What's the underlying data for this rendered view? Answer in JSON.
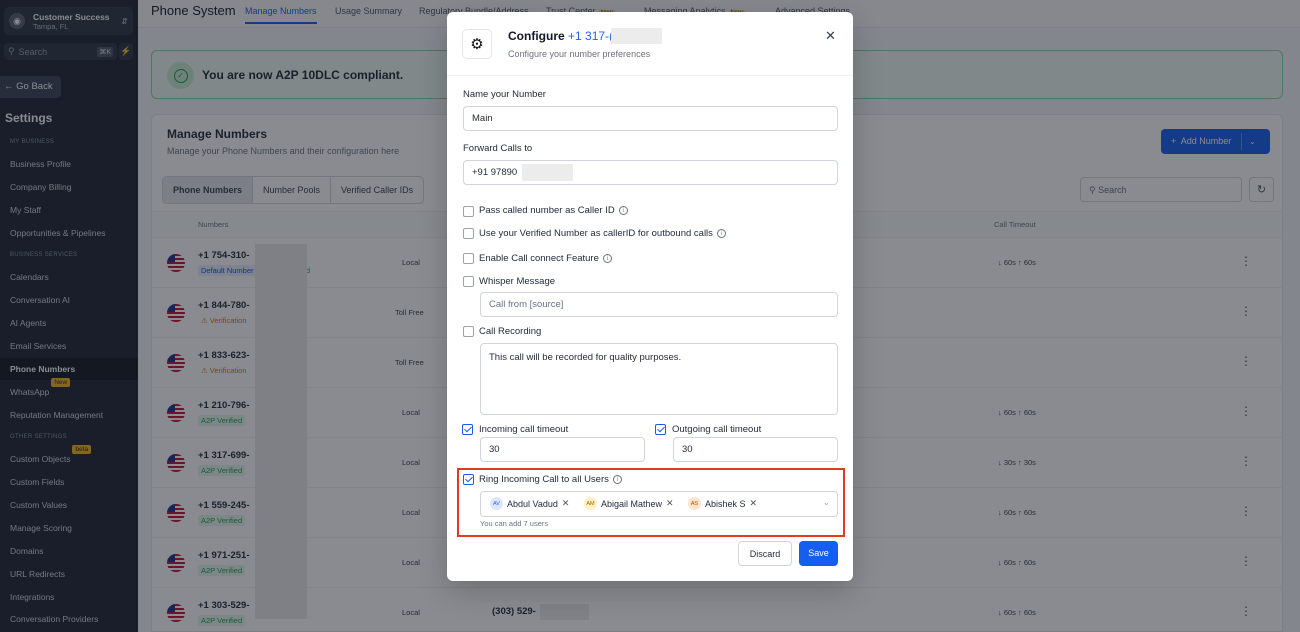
{
  "sidebar": {
    "account": {
      "name": "Customer Success",
      "location": "Tampa, FL"
    },
    "search": {
      "placeholder": "Search",
      "shortcut": "⌘K"
    },
    "go_back": "Go Back",
    "settings_title": "Settings",
    "sections": {
      "my_business": "MY BUSINESS",
      "business_services": "BUSINESS SERVICES",
      "other_settings": "OTHER SETTINGS"
    },
    "items": [
      {
        "label": "Business Profile"
      },
      {
        "label": "Company Billing"
      },
      {
        "label": "My Staff"
      },
      {
        "label": "Opportunities & Pipelines"
      },
      {
        "label": "Calendars"
      },
      {
        "label": "Conversation AI"
      },
      {
        "label": "AI Agents"
      },
      {
        "label": "Email Services"
      },
      {
        "label": "Phone Numbers"
      },
      {
        "label": "WhatsApp",
        "badge": "New"
      },
      {
        "label": "Reputation Management"
      },
      {
        "label": "Custom Objects",
        "badge": "beta"
      },
      {
        "label": "Custom Fields"
      },
      {
        "label": "Custom Values"
      },
      {
        "label": "Manage Scoring"
      },
      {
        "label": "Domains"
      },
      {
        "label": "URL Redirects"
      },
      {
        "label": "Integrations"
      },
      {
        "label": "Conversation Providers"
      }
    ]
  },
  "header": {
    "title": "Phone System",
    "tabs": [
      {
        "label": "Manage Numbers"
      },
      {
        "label": "Usage Summary"
      },
      {
        "label": "Regulatory Bundle/Address"
      },
      {
        "label": "Trust Center",
        "badge": "New"
      },
      {
        "label": "Messaging Analytics",
        "badge": "New"
      },
      {
        "label": "Advanced Settings"
      }
    ]
  },
  "banner": {
    "message": "You are now A2P 10DLC compliant."
  },
  "manage": {
    "title": "Manage Numbers",
    "subtitle": "Manage your Phone Numbers and their configuration here",
    "add_button": "Add Number",
    "segments": [
      "Phone Numbers",
      "Number Pools",
      "Verified Caller IDs"
    ],
    "search_placeholder": "Search",
    "columns": {
      "numbers": "Numbers",
      "call_timeout": "Call Timeout"
    },
    "rows": [
      {
        "number": "+1 754-310-",
        "badge": "Default Number",
        "badge_extra": "ied",
        "type": "Local",
        "timeout": "↓ 60s   ↑ 60s"
      },
      {
        "number": "+1 844-780-",
        "badge": "⚠ Verification",
        "type": "Toll Free",
        "timeout": ""
      },
      {
        "number": "+1 833-623-",
        "badge": "⚠ Verification",
        "type": "Toll Free",
        "timeout": ""
      },
      {
        "number": "+1 210-796-",
        "badge": "A2P Verified",
        "type": "Local",
        "timeout": "↓ 60s   ↑ 60s"
      },
      {
        "number": "+1 317-699-",
        "badge": "A2P Verified",
        "type": "Local",
        "timeout": "↓ 30s   ↑ 30s"
      },
      {
        "number": "+1 559-245-",
        "badge": "A2P Verified",
        "type": "Local",
        "timeout": "↓ 60s   ↑ 60s"
      },
      {
        "number": "+1 971-251-",
        "badge": "A2P Verified",
        "type": "Local",
        "timeout": "↓ 60s   ↑ 60s"
      },
      {
        "number": "+1 303-529-",
        "badge": "A2P Verified",
        "type": "Local",
        "timeout": "↓ 60s   ↑ 60s",
        "extra": "(303) 529-"
      }
    ]
  },
  "modal": {
    "title": "Configure",
    "phone": "+1 317-(",
    "subtitle": "Configure your number preferences",
    "name_label": "Name your Number",
    "name_value": "Main",
    "forward_label": "Forward Calls to",
    "forward_value": "+91 97890",
    "options": {
      "pass_called": "Pass called number as Caller ID",
      "use_verified": "Use your Verified Number as callerID for outbound calls",
      "call_connect": "Enable Call connect Feature",
      "whisper": "Whisper Message",
      "recording": "Call Recording"
    },
    "whisper_placeholder": "Call from [source]",
    "recording_text": "This call will be recorded for quality purposes.",
    "incoming_label": "Incoming call timeout",
    "incoming_value": "30",
    "outgoing_label": "Outgoing call timeout",
    "outgoing_value": "30",
    "ring_label": "Ring Incoming Call to all Users",
    "users": [
      {
        "initials": "AV",
        "name": "Abdul Vadud",
        "color": "#dbe7ff",
        "text_color": "#3b5bdb"
      },
      {
        "initials": "AM",
        "name": "Abigail Mathew",
        "color": "#fff1c2",
        "text_color": "#a16207"
      },
      {
        "initials": "AS",
        "name": "Abishek S",
        "color": "#ffe4cc",
        "text_color": "#c2410c"
      }
    ],
    "hint": "You can add 7 users",
    "discard": "Discard",
    "save": "Save"
  }
}
